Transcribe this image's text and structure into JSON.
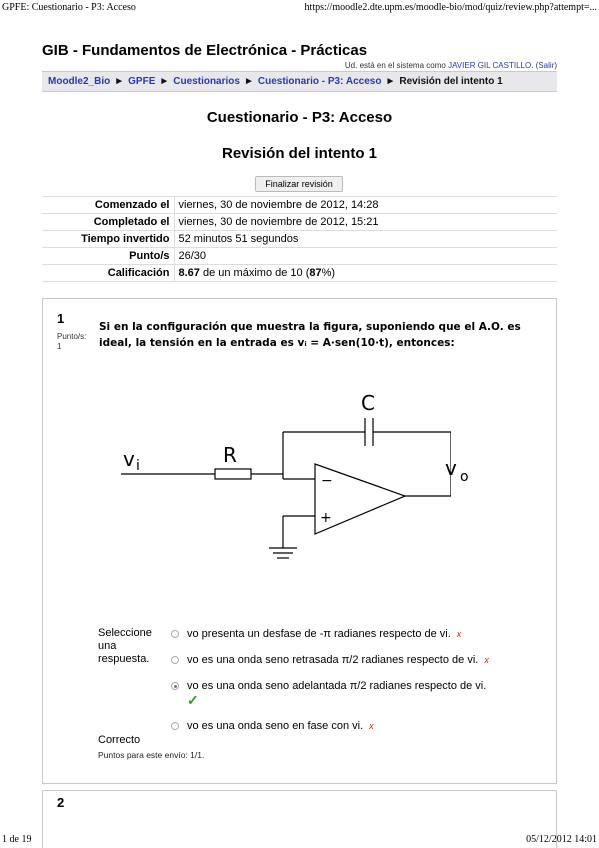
{
  "print": {
    "header_left": "GPFE: Cuestionario - P3: Acceso",
    "header_right": "https://moodle2.dte.upm.es/moodle-bio/mod/quiz/review.php?attempt=...",
    "footer_left": "1 de 19",
    "footer_right": "05/12/2012 14:01"
  },
  "site": {
    "title": "GIB - Fundamentos de Electrónica - Prácticas",
    "login_prefix": "Ud. está en el sistema como",
    "user_name": "JAVIER GIL CASTILLO",
    "logout_open": ". (",
    "logout_label": "Salir",
    "logout_close": ")"
  },
  "breadcrumb": {
    "items": [
      "Moodle2_Bio",
      "GPFE",
      "Cuestionarios",
      "Cuestionario - P3: Acceso"
    ],
    "current": "Revisión del intento 1",
    "separator": "►"
  },
  "page": {
    "quiz_title": "Cuestionario - P3: Acceso",
    "attempt_title": "Revisión del intento 1",
    "finish_button": "Finalizar revisión"
  },
  "summary": {
    "rows": [
      {
        "label": "Comenzado el",
        "value": "viernes, 30 de noviembre de 2012, 14:28"
      },
      {
        "label": "Completado el",
        "value": "viernes, 30 de noviembre de 2012, 15:21"
      },
      {
        "label": "Tiempo invertido",
        "value": "52 minutos 51 segundos"
      },
      {
        "label": "Punto/s",
        "value": "26/30"
      }
    ],
    "grade": {
      "label": "Calificación",
      "score": "8.67",
      "middle": " de un máximo de 10 (",
      "percent": "87",
      "end": "%)"
    }
  },
  "question1": {
    "number": "1",
    "points_label": "Punto/s:",
    "points_value": "1",
    "text": "Si en la configuración que muestra la figura, suponiendo que el A.O. es ideal, la tensión en la entrada es vᵢ = A·sen(10·t), entonces:",
    "figure": {
      "input_label": "v",
      "input_sub": "i",
      "resistor_label": "R",
      "capacitor_label": "C",
      "output_label": "v",
      "output_sub": "o",
      "minus": "−",
      "plus": "+"
    },
    "prompt": "Seleccione una respuesta.",
    "answers": [
      {
        "text": "vo presenta un desfase de -π radianes respecto de vi.",
        "checked": false,
        "mark": "x"
      },
      {
        "text": "vo es una onda seno retrasada π/2 radianes respecto de vi.",
        "checked": false,
        "mark": "x"
      },
      {
        "text": "vo es una onda seno adelantada π/2 radianes respecto de vi.",
        "checked": true,
        "mark": "✓"
      },
      {
        "text": "vo es una onda seno en fase con vi.",
        "checked": false,
        "mark": "x"
      }
    ],
    "feedback": "Correcto",
    "points_message": "Puntos para este envío: 1/1."
  },
  "question2": {
    "number": "2"
  }
}
